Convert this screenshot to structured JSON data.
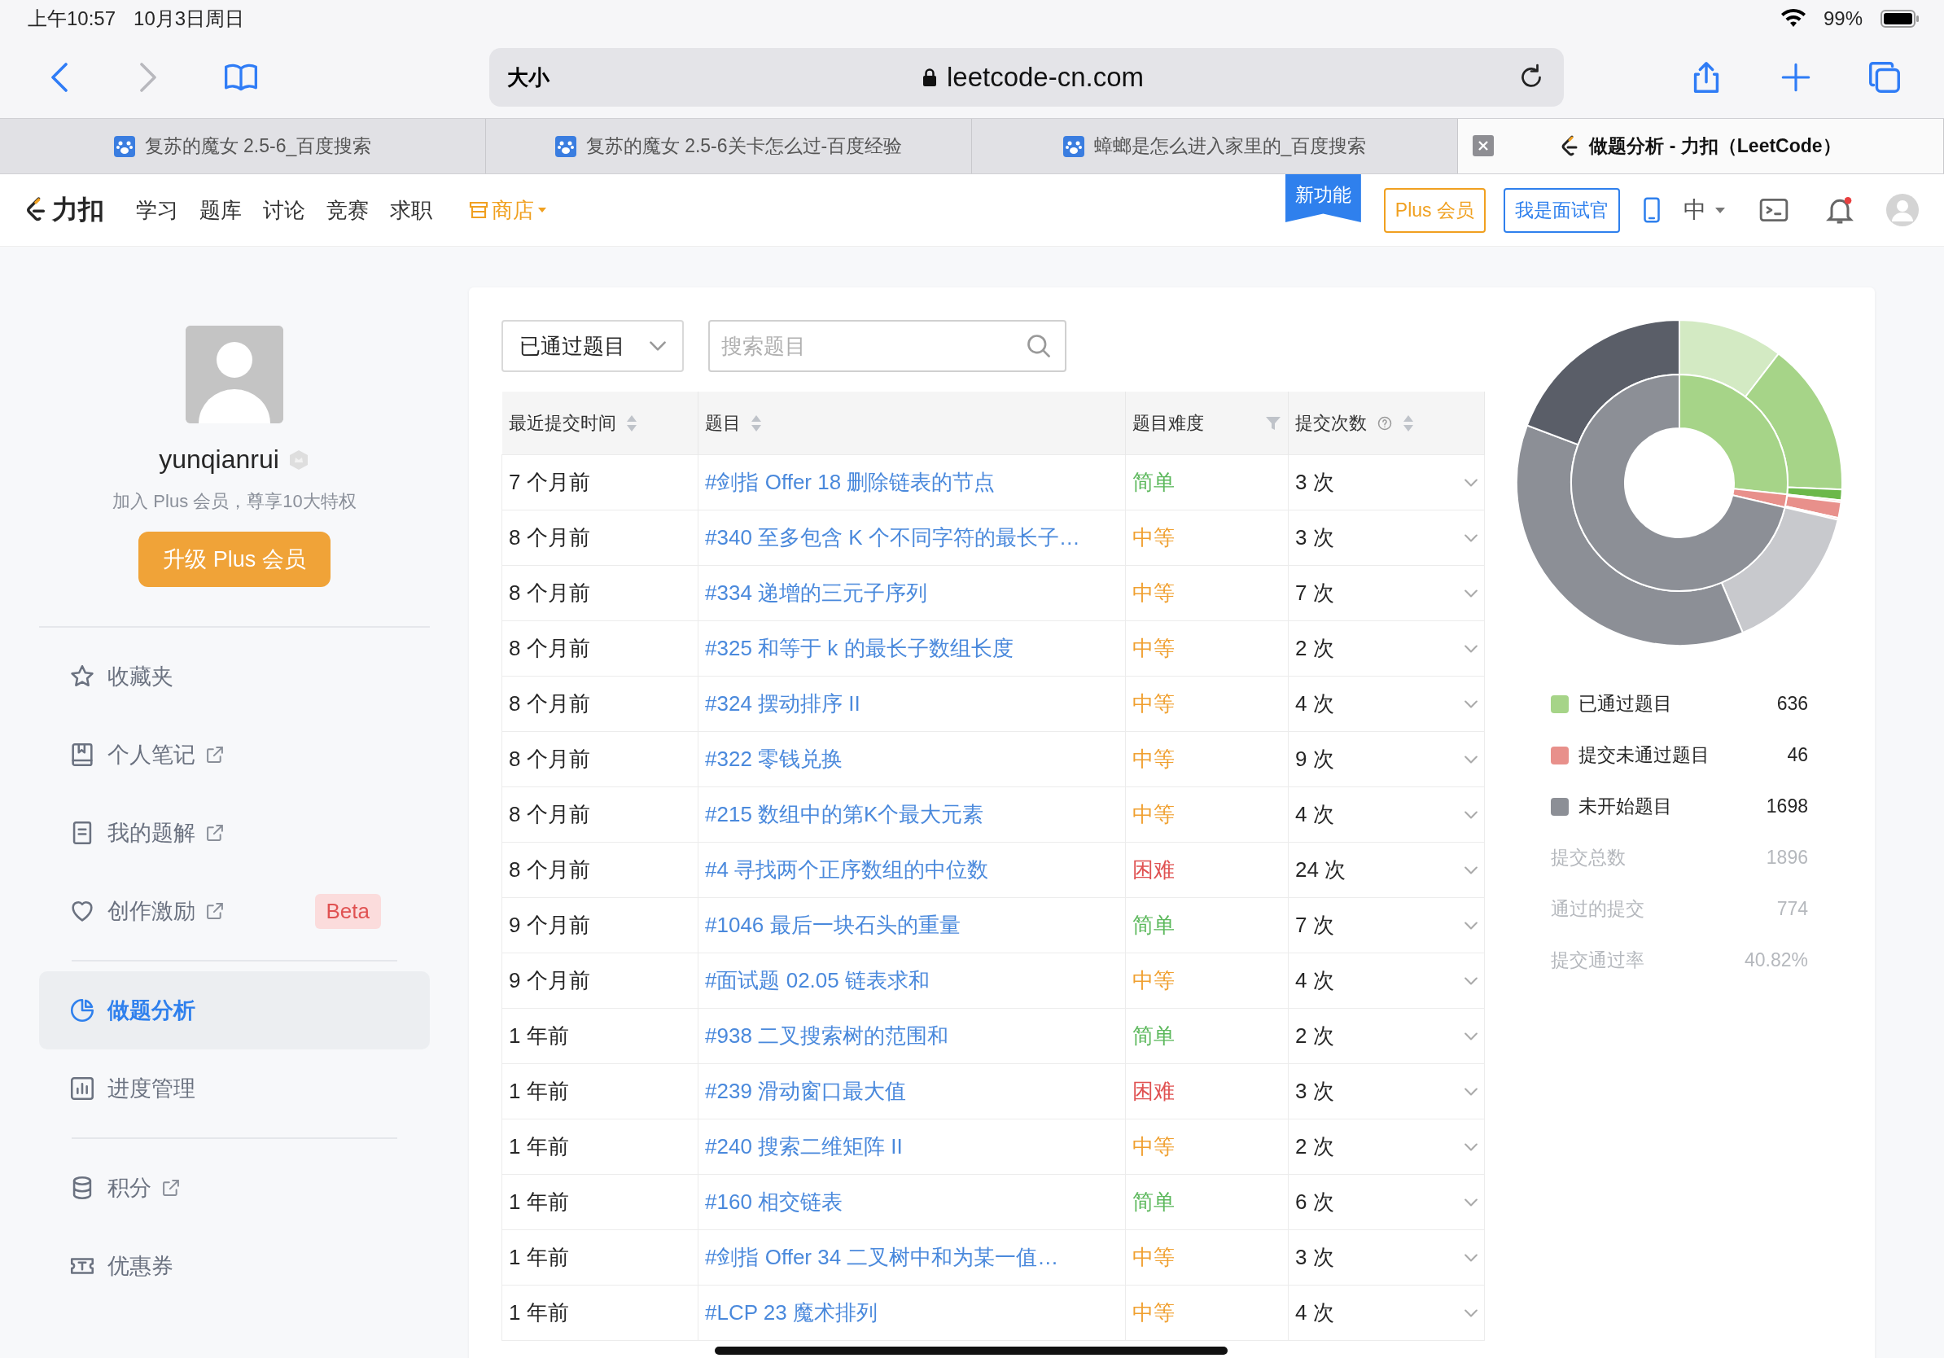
{
  "status_bar": {
    "time": "上午10:57",
    "date": "10月3日周日",
    "battery": "99%"
  },
  "browser": {
    "text_size": "大小",
    "address": "leetcode-cn.com",
    "tabs": [
      {
        "title": "复苏的魔女 2.5-6_百度搜索",
        "selected": false
      },
      {
        "title": "复苏的魔女 2.5-6关卡怎么过-百度经验",
        "selected": false
      },
      {
        "title": "蟑螂是怎么进入家里的_百度搜索",
        "selected": false
      },
      {
        "title": "做题分析 - 力扣（LeetCode）",
        "selected": true
      }
    ]
  },
  "site_nav": {
    "logo": "力扣",
    "items": [
      "学习",
      "题库",
      "讨论",
      "竞赛",
      "求职"
    ],
    "shop": "商店",
    "new_badge": "新功能",
    "plus_button": "Plus 会员",
    "interviewer_button": "我是面试官",
    "language": "中"
  },
  "profile": {
    "username": "yunqianrui",
    "promo": "加入 Plus 会员，尊享10大特权",
    "upgrade_button": "升级 Plus 会员"
  },
  "sidebar": {
    "groups": [
      [
        {
          "label": "收藏夹",
          "external": false,
          "selected": false
        },
        {
          "label": "个人笔记",
          "external": true,
          "selected": false
        },
        {
          "label": "我的题解",
          "external": true,
          "selected": false
        },
        {
          "label": "创作激励",
          "external": true,
          "selected": false,
          "badge": "Beta"
        }
      ],
      [
        {
          "label": "做题分析",
          "external": false,
          "selected": true
        },
        {
          "label": "进度管理",
          "external": false,
          "selected": false
        }
      ],
      [
        {
          "label": "积分",
          "external": true,
          "selected": false
        },
        {
          "label": "优惠券",
          "external": false,
          "selected": false
        }
      ]
    ]
  },
  "filter": {
    "value": "已通过题目",
    "search_placeholder": "搜索题目"
  },
  "table": {
    "columns": [
      "最近提交时间",
      "题目",
      "题目难度",
      "提交次数"
    ],
    "rows": [
      {
        "time": "7 个月前",
        "title": "#剑指 Offer 18 删除链表的节点",
        "difficulty": "简单",
        "kind": "easy",
        "submissions": "3 次"
      },
      {
        "time": "8 个月前",
        "title": "#340 至多包含 K 个不同字符的最长子…",
        "difficulty": "中等",
        "kind": "medium",
        "submissions": "3 次"
      },
      {
        "time": "8 个月前",
        "title": "#334 递增的三元子序列",
        "difficulty": "中等",
        "kind": "medium",
        "submissions": "7 次"
      },
      {
        "time": "8 个月前",
        "title": "#325 和等于 k 的最长子数组长度",
        "difficulty": "中等",
        "kind": "medium",
        "submissions": "2 次"
      },
      {
        "time": "8 个月前",
        "title": "#324 摆动排序 II",
        "difficulty": "中等",
        "kind": "medium",
        "submissions": "4 次"
      },
      {
        "time": "8 个月前",
        "title": "#322 零钱兑换",
        "difficulty": "中等",
        "kind": "medium",
        "submissions": "9 次"
      },
      {
        "time": "8 个月前",
        "title": "#215 数组中的第K个最大元素",
        "difficulty": "中等",
        "kind": "medium",
        "submissions": "4 次"
      },
      {
        "time": "8 个月前",
        "title": "#4 寻找两个正序数组的中位数",
        "difficulty": "困难",
        "kind": "hard",
        "submissions": "24 次"
      },
      {
        "time": "9 个月前",
        "title": "#1046 最后一块石头的重量",
        "difficulty": "简单",
        "kind": "easy",
        "submissions": "7 次"
      },
      {
        "time": "9 个月前",
        "title": "#面试题 02.05 链表求和",
        "difficulty": "中等",
        "kind": "medium",
        "submissions": "4 次"
      },
      {
        "time": "1 年前",
        "title": "#938 二叉搜索树的范围和",
        "difficulty": "简单",
        "kind": "easy",
        "submissions": "2 次"
      },
      {
        "time": "1 年前",
        "title": "#239 滑动窗口最大值",
        "difficulty": "困难",
        "kind": "hard",
        "submissions": "3 次"
      },
      {
        "time": "1 年前",
        "title": "#240 搜索二维矩阵 II",
        "difficulty": "中等",
        "kind": "medium",
        "submissions": "2 次"
      },
      {
        "time": "1 年前",
        "title": "#160 相交链表",
        "difficulty": "简单",
        "kind": "easy",
        "submissions": "6 次"
      },
      {
        "time": "1 年前",
        "title": "#剑指 Offer 34 二叉树中和为某一值…",
        "difficulty": "中等",
        "kind": "medium",
        "submissions": "3 次"
      },
      {
        "time": "1 年前",
        "title": "#LCP 23 魔术排列",
        "difficulty": "中等",
        "kind": "medium",
        "submissions": "4 次"
      }
    ]
  },
  "stats": {
    "legend": [
      {
        "label": "已通过题目",
        "count": "636",
        "color": "#a6d488"
      },
      {
        "label": "提交未通过题目",
        "count": "46",
        "color": "#e8908b"
      },
      {
        "label": "未开始题目",
        "count": "1698",
        "color": "#8c8f96"
      }
    ],
    "totals": [
      {
        "label": "提交总数",
        "value": "1896"
      },
      {
        "label": "通过的提交",
        "value": "774"
      },
      {
        "label": "提交通过率",
        "value": "40.82%"
      }
    ]
  }
}
